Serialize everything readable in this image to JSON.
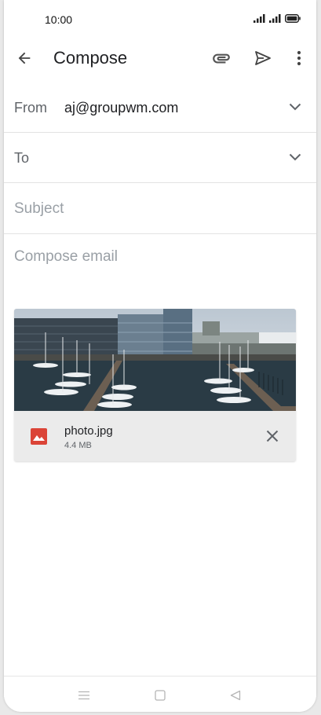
{
  "status_bar": {
    "time": "10:00"
  },
  "app_bar": {
    "title": "Compose",
    "back_icon": "arrow-back-icon",
    "attach_icon": "paperclip-icon",
    "send_icon": "send-icon",
    "more_icon": "more-vert-icon"
  },
  "compose": {
    "from_label": "From",
    "from_value": "aj@groupwm.com",
    "to_label": "To",
    "subject_placeholder": "Subject",
    "body_placeholder": "Compose email"
  },
  "attachment": {
    "filename": "photo.jpg",
    "size": "4.4 MB",
    "type_icon": "image-icon",
    "icon_color": "#db4437",
    "remove_icon": "close-icon"
  },
  "nav_bar": {
    "menu_icon": "menu-icon",
    "home_icon": "square-home-icon",
    "back_icon": "triangle-back-icon"
  }
}
